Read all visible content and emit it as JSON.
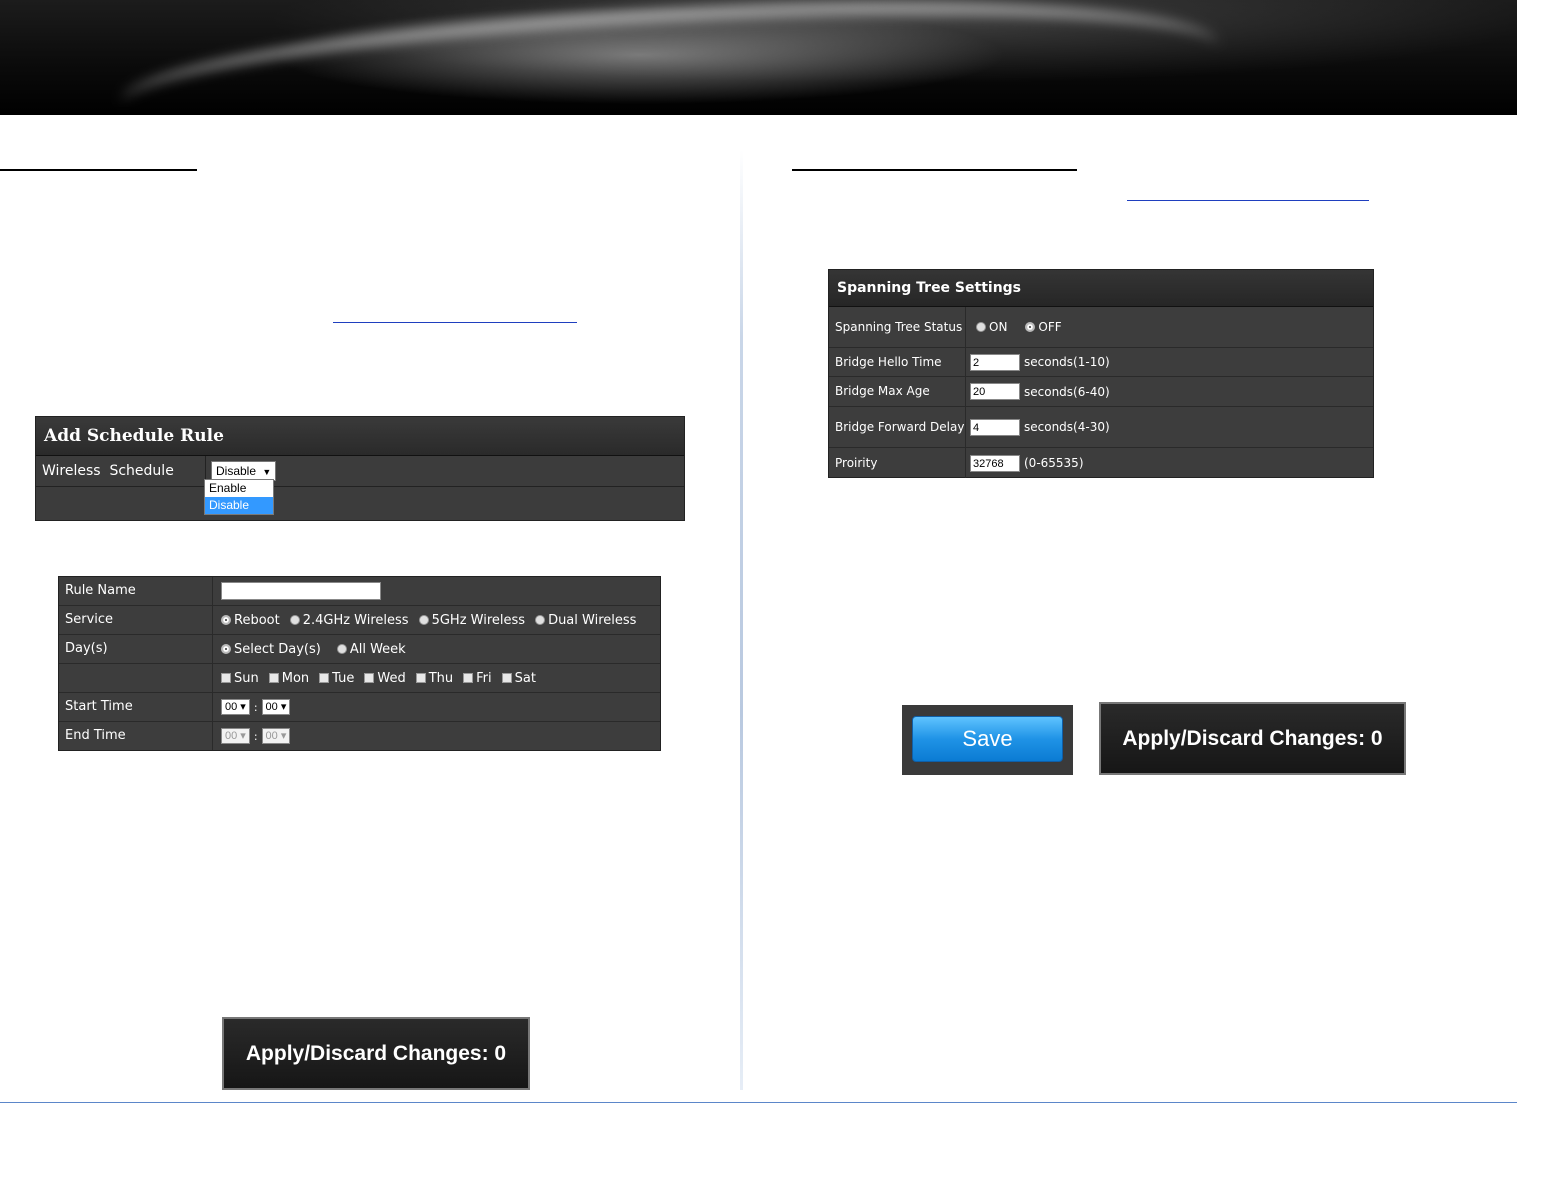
{
  "schedule_panel": {
    "title": "Add Schedule Rule",
    "row_label": "Wireless  Schedule",
    "select_value": "Disable",
    "options": [
      "Enable",
      "Disable"
    ]
  },
  "rule_table": {
    "rule_name_label": "Rule Name",
    "service_label": "Service",
    "service_options": [
      "Reboot",
      "2.4GHz Wireless",
      "5GHz Wireless",
      "Dual Wireless"
    ],
    "days_label": "Day(s)",
    "day_modes": [
      "Select Day(s)",
      "All Week"
    ],
    "weekdays": [
      "Sun",
      "Mon",
      "Tue",
      "Wed",
      "Thu",
      "Fri",
      "Sat"
    ],
    "start_time_label": "Start Time",
    "end_time_label": "End Time",
    "start_hour": "00 ▾",
    "start_min": "00 ▾",
    "end_hour": "00 ▾",
    "end_min": "00 ▾",
    "separator": ":"
  },
  "apply_left": {
    "label": "Apply/Discard Changes: 0"
  },
  "spanning_tree": {
    "title": "Spanning Tree Settings",
    "status_label": "Spanning Tree Status",
    "status_on": "ON",
    "status_off": "OFF",
    "hello_label": "Bridge Hello Time",
    "hello_value": "2",
    "hello_unit": "seconds(1-10)",
    "max_age_label": "Bridge Max Age",
    "max_age_value": "20",
    "max_age_unit": "seconds(6-40)",
    "fwd_delay_label": "Bridge Forward Delay",
    "fwd_delay_value": "4",
    "fwd_delay_unit": "seconds(4-30)",
    "priority_label": "Proirity",
    "priority_value": "32768",
    "priority_unit": "(0-65535)"
  },
  "save_button": {
    "label": "Save"
  },
  "apply_right": {
    "label": "Apply/Discard Changes: 0"
  }
}
